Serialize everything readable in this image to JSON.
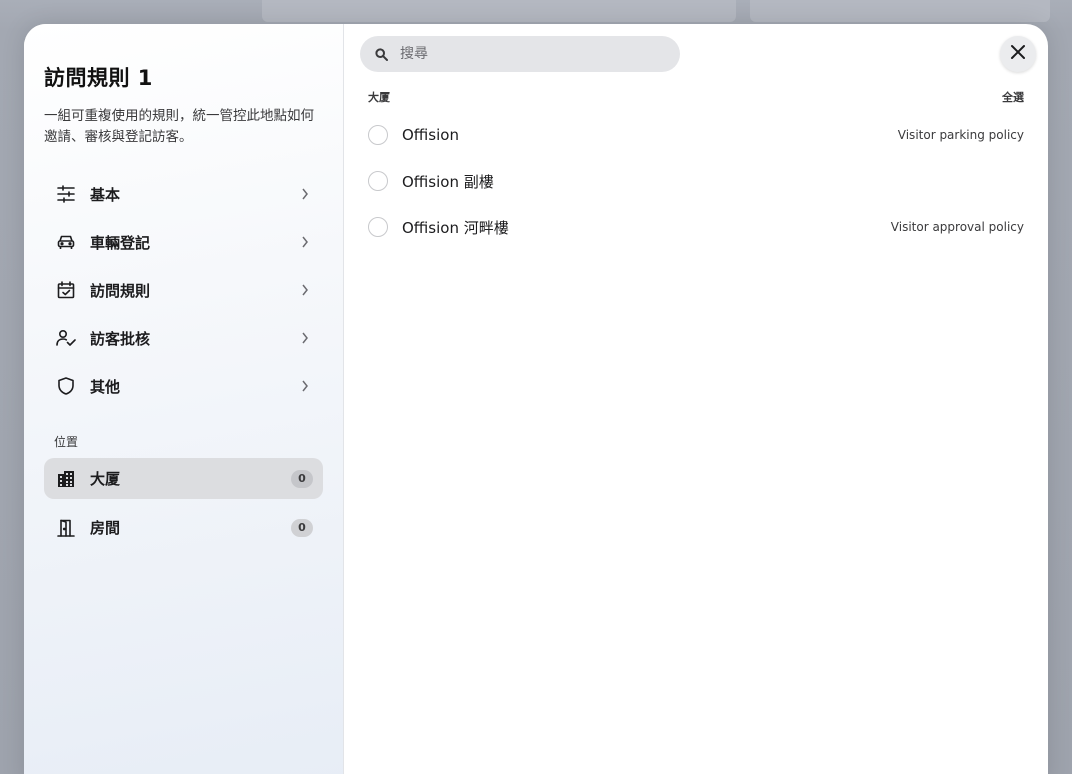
{
  "colors": {
    "accent": "#1c1c1e",
    "active_bg": "#dcdde0",
    "badge_bg": "#d0d1d4"
  },
  "sidebar": {
    "title": "訪問規則 1",
    "description": "一組可重複使用的規則，統一管控此地點如何邀請、審核與登記訪客。",
    "nav": [
      {
        "label": "基本",
        "icon": "sliders-icon"
      },
      {
        "label": "車輛登記",
        "icon": "car-icon"
      },
      {
        "label": "訪問規則",
        "icon": "calendar-check-icon"
      },
      {
        "label": "訪客批核",
        "icon": "user-check-icon"
      },
      {
        "label": "其他",
        "icon": "shield-icon"
      }
    ],
    "section_label": "位置",
    "locations": [
      {
        "label": "大厦",
        "count": "0",
        "icon": "building-icon"
      },
      {
        "label": "房間",
        "count": "0",
        "icon": "door-icon"
      }
    ]
  },
  "main": {
    "search": {
      "placeholder": "搜尋",
      "value": ""
    },
    "list_header": "大厦",
    "select_all": "全選",
    "rows": [
      {
        "name": "Offision",
        "policy": "Visitor parking policy"
      },
      {
        "name": "Offision 副樓",
        "policy": ""
      },
      {
        "name": "Offision 河畔樓",
        "policy": "Visitor approval policy"
      }
    ]
  }
}
